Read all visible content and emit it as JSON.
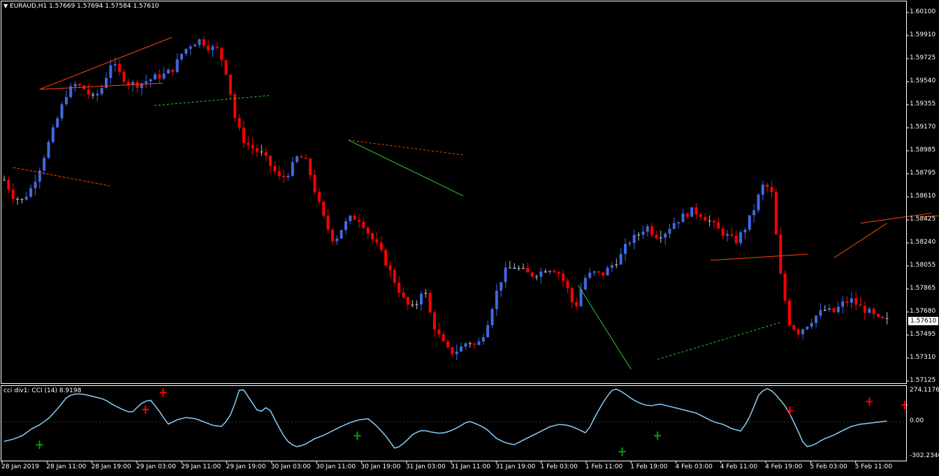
{
  "symbol_header": {
    "arrow": "▼",
    "text": "EURAUD,H1  1.57669 1.57694 1.57584 1.57610"
  },
  "indicator_header": "cci div1: CCI (14) 8.9198",
  "price_axis": [
    "1.60100",
    "1.59910",
    "1.59725",
    "1.59540",
    "1.59355",
    "1.59170",
    "1.58985",
    "1.58795",
    "1.58610",
    "1.58425",
    "1.58240",
    "1.58055",
    "1.57865",
    "1.57680",
    "1.57495",
    "1.57310",
    "1.57125"
  ],
  "current_price": "1.57610",
  "cci_axis": [
    "274.1176",
    "0.00",
    "-302.2346"
  ],
  "time_axis": [
    "28 Jan 2019",
    "28 Jan 11:00",
    "28 Jan 19:00",
    "29 Jan 03:00",
    "29 Jan 11:00",
    "29 Jan 19:00",
    "30 Jan 03:00",
    "30 Jan 11:00",
    "30 Jan 19:00",
    "31 Jan 03:00",
    "31 Jan 11:00",
    "31 Jan 19:00",
    "1 Feb 03:00",
    "1 Feb 11:00",
    "1 Feb 19:00",
    "4 Feb 03:00",
    "4 Feb 11:00",
    "4 Feb 19:00",
    "5 Feb 03:00",
    "5 Feb 11:00"
  ],
  "colors": {
    "background": "#000000",
    "bull": "#4169e1",
    "bear": "#ff0000",
    "doji": "#c0c0c0",
    "cci_line": "#87cefa",
    "bear_div": "#ff4500",
    "bull_div": "#32cd32",
    "axis": "#ffffff"
  },
  "chart_data": {
    "type": "candlestick",
    "symbol": "EURAUD",
    "timeframe": "H1",
    "last_bar": {
      "open": 1.57669,
      "high": 1.57694,
      "low": 1.57584,
      "close": 1.5761
    },
    "ylim": [
      1.57125,
      1.601
    ],
    "cci_period": 14,
    "cci_value": 8.9198,
    "cci_ylim": [
      -302.2346,
      274.1176
    ],
    "close_path": [
      1.5875,
      1.5862,
      1.5858,
      1.5868,
      1.5885,
      1.5905,
      1.5925,
      1.5945,
      1.5952,
      1.5948,
      1.594,
      1.595,
      1.597,
      1.596,
      1.5953,
      1.5952,
      1.5955,
      1.5958,
      1.596,
      1.5965,
      1.5978,
      1.5985,
      1.5988,
      1.5982,
      1.598,
      1.596,
      1.592,
      1.5905,
      1.59,
      1.5895,
      1.5885,
      1.5875,
      1.5882,
      1.5895,
      1.5888,
      1.5862,
      1.584,
      1.5825,
      1.5838,
      1.5845,
      1.5843,
      1.583,
      1.582,
      1.5805,
      1.579,
      1.5775,
      1.577,
      1.579,
      1.576,
      1.5745,
      1.5735,
      1.5738,
      1.5745,
      1.574,
      1.5755,
      1.578,
      1.58,
      1.5805,
      1.5802,
      1.5798,
      1.58,
      1.5804,
      1.5802,
      1.579,
      1.577,
      1.5795,
      1.58,
      1.5798,
      1.5805,
      1.5812,
      1.5825,
      1.583,
      1.5838,
      1.583,
      1.5832,
      1.584,
      1.5845,
      1.585,
      1.5848,
      1.5842,
      1.5835,
      1.583,
      1.5825,
      1.5835,
      1.585,
      1.587,
      1.5868,
      1.58,
      1.576,
      1.5752,
      1.5758,
      1.5765,
      1.577,
      1.5768,
      1.5775,
      1.5778,
      1.5772,
      1.5768,
      1.5762,
      1.5761
    ],
    "cci_path": [
      -170,
      -150,
      -120,
      -60,
      -20,
      40,
      130,
      230,
      250,
      240,
      220,
      200,
      150,
      110,
      80,
      160,
      200,
      100,
      -20,
      20,
      40,
      30,
      0,
      -30,
      -40,
      80,
      320,
      200,
      80,
      140,
      -20,
      -160,
      -220,
      -200,
      -150,
      -120,
      -80,
      -40,
      -5,
      20,
      30,
      -40,
      -130,
      -240,
      -180,
      -100,
      -70,
      -90,
      -100,
      -80,
      -40,
      10,
      -20,
      -60,
      -140,
      -180,
      -200,
      -160,
      -120,
      -80,
      -40,
      -20,
      -30,
      -60,
      -100,
      60,
      200,
      300,
      260,
      200,
      160,
      140,
      160,
      140,
      120,
      100,
      80,
      40,
      0,
      -20,
      -60,
      -80,
      60,
      260,
      300,
      220,
      120,
      -40,
      -220,
      -200,
      -150,
      -120,
      -80,
      -40,
      -20,
      -10,
      0,
      8.9
    ],
    "divergence_arrows": [
      {
        "type": "sell",
        "cci": 260,
        "label": "red arrow"
      },
      {
        "type": "sell",
        "cci": 110,
        "label": "red arrow"
      },
      {
        "type": "buy",
        "cci": -200,
        "label": "green arrow"
      },
      {
        "type": "buy",
        "cci": -120,
        "label": "green arrow"
      },
      {
        "type": "buy",
        "cci": -260,
        "label": "green arrow"
      },
      {
        "type": "buy",
        "cci": -120,
        "label": "green arrow"
      },
      {
        "type": "sell",
        "cci": 100,
        "label": "red arrow"
      },
      {
        "type": "sell",
        "cci": 180,
        "label": "red arrow"
      },
      {
        "type": "sell",
        "cci": 150,
        "label": "red arrow"
      },
      {
        "type": "sell",
        "cci": 60,
        "label": "red arrow"
      }
    ]
  }
}
